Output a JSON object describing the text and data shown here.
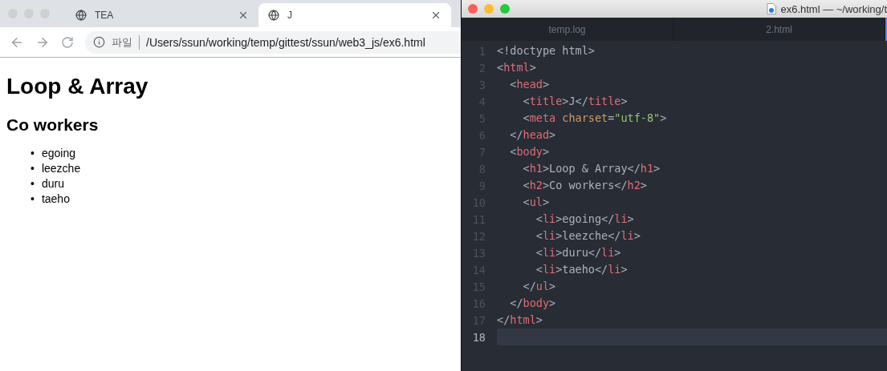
{
  "browser": {
    "tabs": [
      {
        "title": "TEA",
        "selected": false
      },
      {
        "title": "J",
        "selected": true
      }
    ],
    "address_bar": {
      "scheme_label": "파일",
      "url": "/Users/ssun/working/temp/gittest/ssun/web3_js/ex6.html"
    },
    "page": {
      "heading": "Loop & Array",
      "subheading": "Co workers",
      "items": [
        {
          "marker": "•",
          "text": "egoing"
        },
        {
          "marker": "•",
          "text": "leezche"
        },
        {
          "marker": "•",
          "text": "duru"
        },
        {
          "marker": "•",
          "text": "taeho"
        }
      ]
    }
  },
  "editor": {
    "window_title": "ex6.html — ~/working/t",
    "tabs": [
      {
        "title": "temp.log",
        "selected": false
      },
      {
        "title": "2.html",
        "selected": false
      }
    ],
    "lines": [
      {
        "number": "1",
        "current": false,
        "tokens": [
          {
            "kind": "punct",
            "text": "<!doctype html>"
          }
        ]
      },
      {
        "number": "2",
        "current": false,
        "tokens": [
          {
            "kind": "punct",
            "text": "<"
          },
          {
            "kind": "tag",
            "text": "html"
          },
          {
            "kind": "punct",
            "text": ">"
          }
        ]
      },
      {
        "number": "3",
        "current": false,
        "tokens": [
          {
            "kind": "punct",
            "text": "  <"
          },
          {
            "kind": "tag",
            "text": "head"
          },
          {
            "kind": "punct",
            "text": ">"
          }
        ]
      },
      {
        "number": "4",
        "current": false,
        "tokens": [
          {
            "kind": "punct",
            "text": "    <"
          },
          {
            "kind": "tag",
            "text": "title"
          },
          {
            "kind": "punct",
            "text": ">J</"
          },
          {
            "kind": "tag",
            "text": "title"
          },
          {
            "kind": "punct",
            "text": ">"
          }
        ]
      },
      {
        "number": "5",
        "current": false,
        "tokens": [
          {
            "kind": "punct",
            "text": "    <"
          },
          {
            "kind": "tag",
            "text": "meta"
          },
          {
            "kind": "attr",
            "text": " charset"
          },
          {
            "kind": "punct",
            "text": "="
          },
          {
            "kind": "string",
            "text": "\"utf-8\""
          },
          {
            "kind": "punct",
            "text": ">"
          }
        ]
      },
      {
        "number": "6",
        "current": false,
        "tokens": [
          {
            "kind": "punct",
            "text": "  </"
          },
          {
            "kind": "tag",
            "text": "head"
          },
          {
            "kind": "punct",
            "text": ">"
          }
        ]
      },
      {
        "number": "7",
        "current": false,
        "tokens": [
          {
            "kind": "punct",
            "text": "  <"
          },
          {
            "kind": "tag",
            "text": "body"
          },
          {
            "kind": "punct",
            "text": ">"
          }
        ]
      },
      {
        "number": "8",
        "current": false,
        "tokens": [
          {
            "kind": "punct",
            "text": "    <"
          },
          {
            "kind": "tag",
            "text": "h1"
          },
          {
            "kind": "punct",
            "text": ">Loop & Array</"
          },
          {
            "kind": "tag",
            "text": "h1"
          },
          {
            "kind": "punct",
            "text": ">"
          }
        ]
      },
      {
        "number": "9",
        "current": false,
        "tokens": [
          {
            "kind": "punct",
            "text": "    <"
          },
          {
            "kind": "tag",
            "text": "h2"
          },
          {
            "kind": "punct",
            "text": ">Co workers</"
          },
          {
            "kind": "tag",
            "text": "h2"
          },
          {
            "kind": "punct",
            "text": ">"
          }
        ]
      },
      {
        "number": "10",
        "current": false,
        "tokens": [
          {
            "kind": "punct",
            "text": "    <"
          },
          {
            "kind": "tag",
            "text": "ul"
          },
          {
            "kind": "punct",
            "text": ">"
          }
        ]
      },
      {
        "number": "11",
        "current": false,
        "tokens": [
          {
            "kind": "punct",
            "text": "      <"
          },
          {
            "kind": "tag",
            "text": "li"
          },
          {
            "kind": "punct",
            "text": ">egoing</"
          },
          {
            "kind": "tag",
            "text": "li"
          },
          {
            "kind": "punct",
            "text": ">"
          }
        ]
      },
      {
        "number": "12",
        "current": false,
        "tokens": [
          {
            "kind": "punct",
            "text": "      <"
          },
          {
            "kind": "tag",
            "text": "li"
          },
          {
            "kind": "punct",
            "text": ">leezche</"
          },
          {
            "kind": "tag",
            "text": "li"
          },
          {
            "kind": "punct",
            "text": ">"
          }
        ]
      },
      {
        "number": "13",
        "current": false,
        "tokens": [
          {
            "kind": "punct",
            "text": "      <"
          },
          {
            "kind": "tag",
            "text": "li"
          },
          {
            "kind": "punct",
            "text": ">duru</"
          },
          {
            "kind": "tag",
            "text": "li"
          },
          {
            "kind": "punct",
            "text": ">"
          }
        ]
      },
      {
        "number": "14",
        "current": false,
        "tokens": [
          {
            "kind": "punct",
            "text": "      <"
          },
          {
            "kind": "tag",
            "text": "li"
          },
          {
            "kind": "punct",
            "text": ">taeho</"
          },
          {
            "kind": "tag",
            "text": "li"
          },
          {
            "kind": "punct",
            "text": ">"
          }
        ]
      },
      {
        "number": "15",
        "current": false,
        "tokens": [
          {
            "kind": "punct",
            "text": "    </"
          },
          {
            "kind": "tag",
            "text": "ul"
          },
          {
            "kind": "punct",
            "text": ">"
          }
        ]
      },
      {
        "number": "16",
        "current": false,
        "tokens": [
          {
            "kind": "punct",
            "text": "  </"
          },
          {
            "kind": "tag",
            "text": "body"
          },
          {
            "kind": "punct",
            "text": ">"
          }
        ]
      },
      {
        "number": "17",
        "current": false,
        "tokens": [
          {
            "kind": "punct",
            "text": "</"
          },
          {
            "kind": "tag",
            "text": "html"
          },
          {
            "kind": "punct",
            "text": ">"
          }
        ]
      },
      {
        "number": "18",
        "current": true
      }
    ]
  }
}
